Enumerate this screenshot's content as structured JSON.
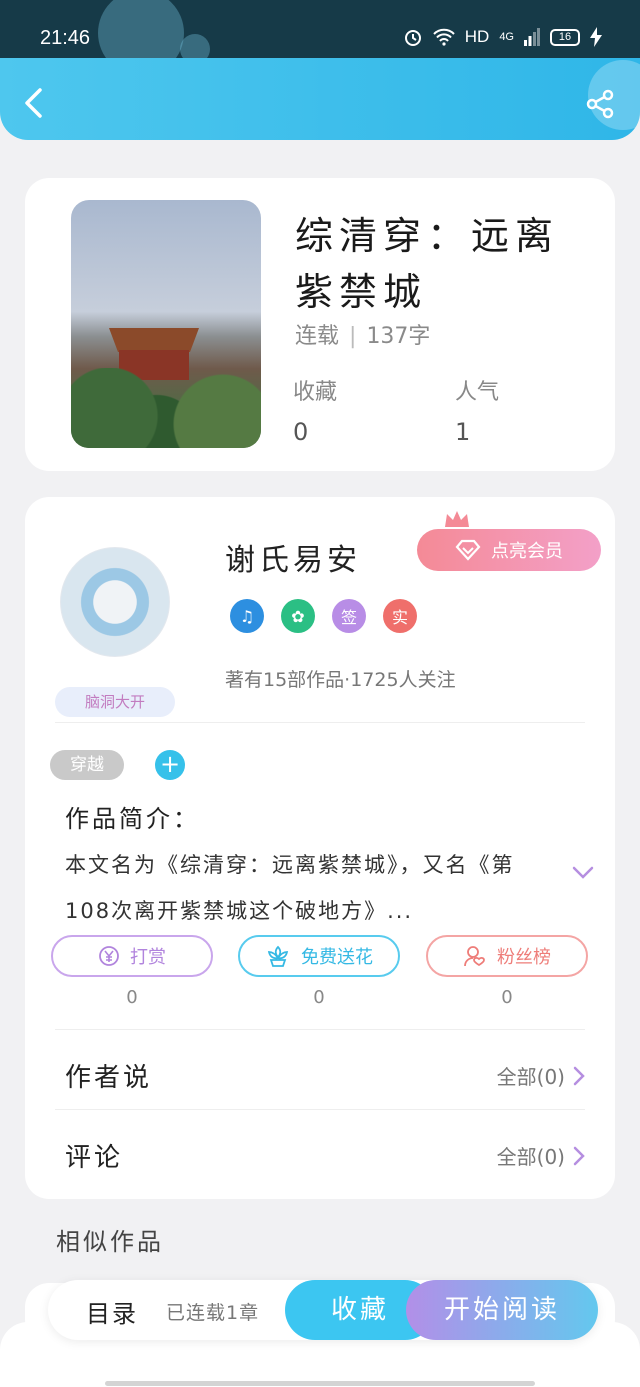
{
  "status_bar": {
    "time": "21:46",
    "network": "HD",
    "signal": "4G",
    "battery": "16"
  },
  "book": {
    "title": "综清穿：远离紫禁城",
    "status": "连载",
    "word_count": "137字",
    "stats": [
      {
        "label": "收藏",
        "value": "0"
      },
      {
        "label": "人气",
        "value": "1"
      }
    ]
  },
  "author": {
    "name": "谢氏易安",
    "avatar_tag": "脑洞大开",
    "vip_button": "点亮会员",
    "badges": [
      {
        "text": "♫",
        "color": "#2d8fe0"
      },
      {
        "text": "✿",
        "color": "#2bbf84"
      },
      {
        "text": "签",
        "color": "#b88de6"
      },
      {
        "text": "实",
        "color": "#ef6f6b"
      }
    ],
    "stats_text": "著有15部作品·1725人关注"
  },
  "tags": {
    "genre": "穿越",
    "add": "+"
  },
  "intro": {
    "title": "作品简介：",
    "text": "本文名为《综清穿：远离紫禁城》，又名《第108次离开紫禁城这个破地方》..."
  },
  "actions": [
    {
      "label": "打赏",
      "count": "0",
      "icon": "yen-icon"
    },
    {
      "label": "免费送花",
      "count": "0",
      "icon": "flower-icon"
    },
    {
      "label": "粉丝榜",
      "count": "0",
      "icon": "fans-icon"
    }
  ],
  "sections": [
    {
      "label": "作者说",
      "right": "全部(0)"
    },
    {
      "label": "评论",
      "right": "全部(0)"
    }
  ],
  "similar_title": "相似作品",
  "bottom_bar": {
    "toc": "目录",
    "toc_sub": "已连载1章",
    "favorite": "收藏",
    "start_reading": "开始阅读"
  },
  "colors": {
    "header": "#3fbfeb",
    "accent_blue": "#3cc6f1",
    "vip_pink": "#f48a96",
    "purple": "#b28fe8"
  }
}
